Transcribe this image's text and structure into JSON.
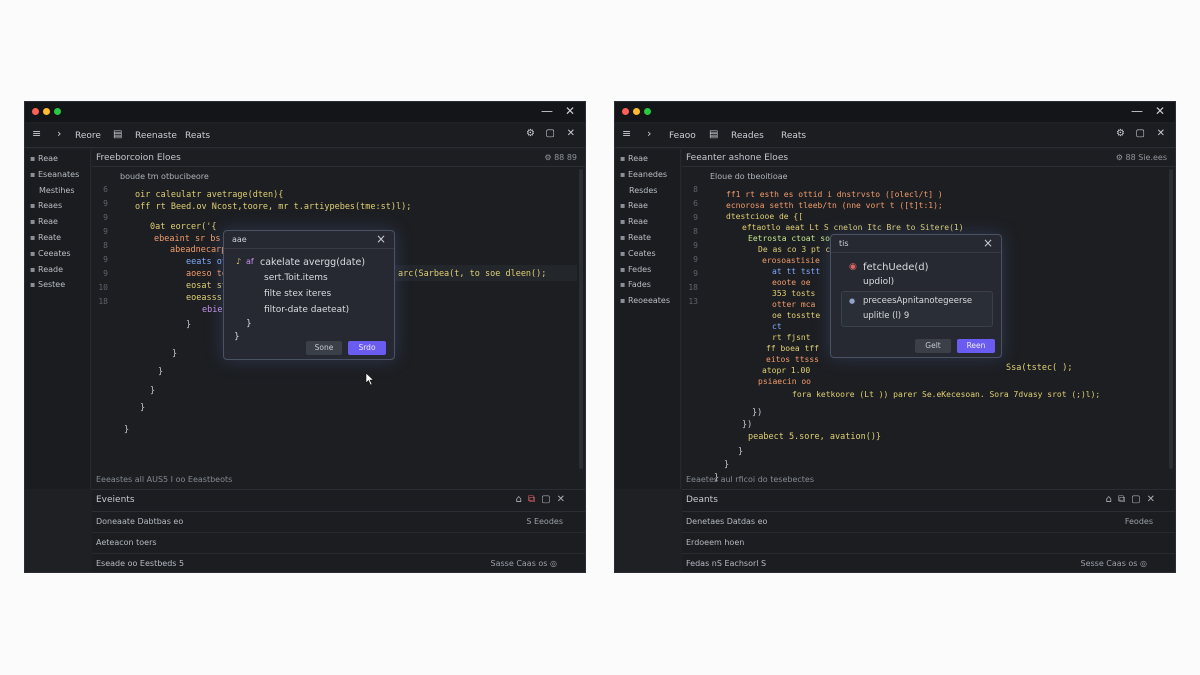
{
  "left": {
    "toolbar": {
      "item1": "Reore",
      "item2": "Reenaste",
      "item3": "Reats"
    },
    "sidebar": [
      "Reae",
      "Eseanates",
      "Mestihes",
      "Reaes",
      "Reae",
      "Reate",
      "Ceeates",
      "Reade",
      "Sestee"
    ],
    "editor": {
      "title": "Freeborcoion  Eloes",
      "icons": "⚙ 88  89",
      "breadcrumb": "boude  tm  otbucibeore"
    },
    "line_numbers": [
      "6",
      "9",
      "9",
      "9",
      "8",
      "9",
      "9",
      "10",
      "18"
    ],
    "code": [
      "oir  caleulatr avetrage(dten){",
      "off  rt  Beed.ov  Ncost,toore,  mr  t.artiypebes(tme:st)l);",
      "0at  eorcer('{",
      "ebeaint  sr  bs",
      "abeadnecarp",
      "eeats  ot",
      "aoeso  te",
      "eosat  st",
      "eoeasss",
      "ebiel",
      "}",
      "}",
      "}",
      "}",
      "}",
      "}"
    ],
    "code_tail": "arc(Sarbea(t, to soe dleen();",
    "status": "Eeeastes  all  AUS5  I  oo  Eeastbeots",
    "modal": {
      "title": "aae",
      "lines": [
        "cakelate avergg(date)",
        "sert.Toit.items",
        "filte stex iteres",
        "filtor-date daeteat)",
        "}",
        "}"
      ],
      "cancel": "Sone",
      "confirm": "Srdo"
    },
    "panel": {
      "title": "Eveients",
      "row1_left": "Doneaate  Dabtbas  eo",
      "row1_right": "S  Eeodes",
      "row2_left": "Aeteacon  toers",
      "row3_left": "Eseade  oo  Eestbeds  5",
      "row3_right": "Sasse  Caas  os  ◎"
    }
  },
  "right": {
    "toolbar": {
      "item1": "Feaoo",
      "item2": "Reades",
      "item3": "Reats"
    },
    "sidebar": [
      "Reae",
      "Eeanedes",
      "Resdes",
      "Reae",
      "Reae",
      "Reate",
      "Ceates",
      "Fedes",
      "Fades",
      "Reoeeates"
    ],
    "editor": {
      "title": "Feeanter ashone  Eloes",
      "icons": "⚙ 88  Sie.ees",
      "breadcrumb": "Eloue  do  tbeoitioae"
    },
    "line_numbers": [
      "8",
      "6",
      "9",
      "8",
      "9",
      "9",
      "9",
      "18",
      "13"
    ],
    "code": [
      "ff1  rt  esth  es  ottid  i  dnstrvsto  ([olecl/t]  )",
      "ecnorosa  setth  tleeb/tn  (nne  vort  t  ([t]t:1);",
      "dtestciooe  de  {[",
      "eftaotlo  aeat  Lt  S  cnelon  Itc  Bre  to  Sitere(1)",
      "Eetrosta  ctoat  soo",
      "De  as  co  3  pt  c",
      "erosoastisie",
      "at  tt  tstt",
      "eoote  oe",
      "353  tosts",
      "otter  mca",
      "oe  tosstte",
      "ct",
      "rt  fjsnt",
      "ff  boea  tff",
      "eitos  ttsss",
      "atopr  1.00",
      "psiaecin  oo"
    ],
    "code_after": [
      "fora  ketkoore  (Lt  ))  parer  Se.eKecesoan.  Sora  7dvasy  srot  (;)l);",
      "})",
      "})",
      "peabect  5.sore,  avation()}",
      "}",
      "}",
      "}"
    ],
    "code_tail": "Ssa(tstec(  );",
    "status": "Eeaetes  aul  rficoi  do  tesebectes",
    "modal": {
      "title": "tis",
      "item1_title": "fetchUede(d)",
      "item1_sub": "updiol)",
      "item2_title": "preceesApnitanotegeerse",
      "item2_sub": "uplitle (l)  9",
      "cancel": "Gelt",
      "confirm": "Reen"
    },
    "panel": {
      "title": "Deants",
      "row1_left": "Denetaes  Datdas  eo",
      "row1_right": "Feodes",
      "row2_left": "Erdoeem  hoen",
      "row3_left": "Fedas  nS  Eachsorl  S",
      "row3_right": "Sesse  Caas  os  ◎"
    }
  }
}
